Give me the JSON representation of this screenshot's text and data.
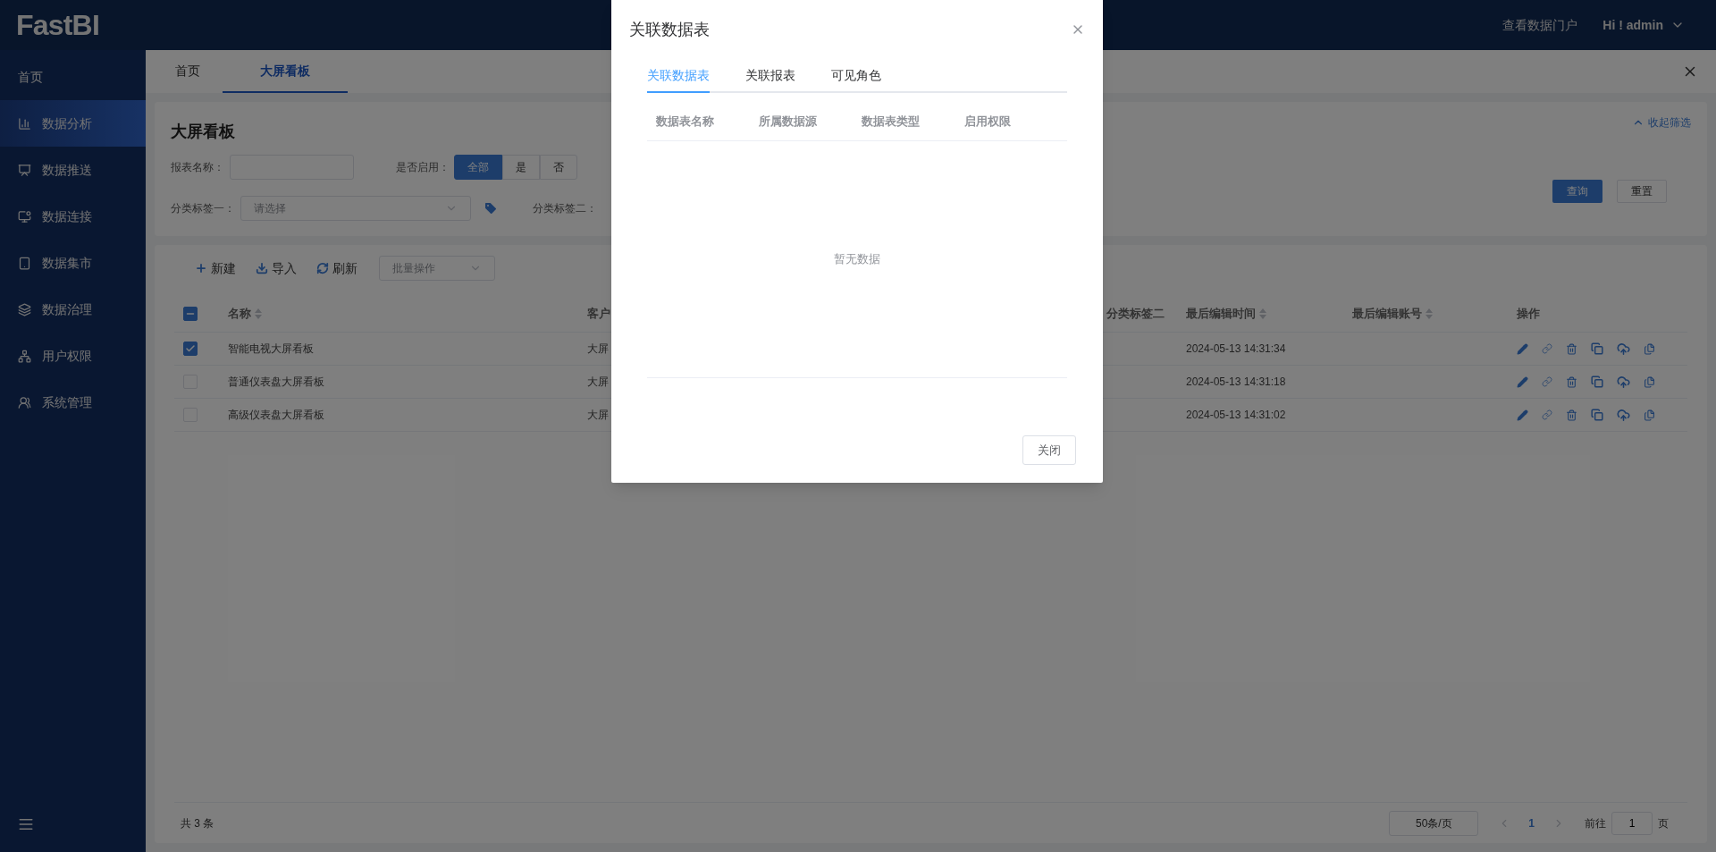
{
  "brand": "FastBI",
  "header": {
    "portal_link": "查看数据门户",
    "user_menu": "Hi ! admin"
  },
  "sidebar": {
    "home": "首页",
    "items": [
      {
        "label": "数据分析",
        "selected": true
      },
      {
        "label": "数据推送",
        "selected": false
      },
      {
        "label": "数据连接",
        "selected": false
      },
      {
        "label": "数据集市",
        "selected": false
      },
      {
        "label": "数据治理",
        "selected": false
      },
      {
        "label": "用户权限",
        "selected": false
      },
      {
        "label": "系统管理",
        "selected": false
      }
    ]
  },
  "tabs": [
    {
      "label": "首页",
      "selected": false
    },
    {
      "label": "大屏看板",
      "selected": true
    }
  ],
  "filter": {
    "title": "大屏看板",
    "collapse_link": "收起筛选",
    "name_label": "报表名称：",
    "enabled_label": "是否启用：",
    "enabled_options": [
      {
        "label": "全部",
        "selected": true
      },
      {
        "label": "是",
        "selected": false
      },
      {
        "label": "否",
        "selected": false
      }
    ],
    "tag1_label": "分类标签一：",
    "tag1_placeholder": "请选择",
    "tag2_label": "分类标签二：",
    "query_button": "查询",
    "reset_button": "重置"
  },
  "toolbar": {
    "new_button": "新建",
    "import_button": "导入",
    "refresh_button": "刷新",
    "batch_placeholder": "批量操作"
  },
  "table": {
    "select_all_indeterminate": true,
    "columns": [
      {
        "label": "名称",
        "sortable": true
      },
      {
        "label": "客户",
        "sortable": false
      },
      {
        "label": "分类标签二",
        "sortable": false
      },
      {
        "label": "最后编辑时间",
        "sortable": true
      },
      {
        "label": "最后编辑账号",
        "sortable": true
      },
      {
        "label": "操作",
        "sortable": false
      }
    ],
    "rows": [
      {
        "checked": true,
        "name": "智能电视大屏看板",
        "column_2": "大屏",
        "last_edit_time": "2024-05-13 14:31:34"
      },
      {
        "checked": false,
        "name": "普通仪表盘大屏看板",
        "column_2": "大屏",
        "last_edit_time": "2024-05-13 14:31:18"
      },
      {
        "checked": false,
        "name": "高级仪表盘大屏看板",
        "column_2": "大屏",
        "last_edit_time": "2024-05-13 14:31:02"
      }
    ]
  },
  "footer": {
    "total": "共 3 条",
    "page_size": "50条/页",
    "pages": [
      {
        "label": "1",
        "selected": true
      }
    ],
    "goto_label": "前往",
    "goto_value": "1",
    "goto_suffix": "页"
  },
  "modal": {
    "title": "关联数据表",
    "tabs": [
      {
        "label": "关联数据表",
        "selected": true
      },
      {
        "label": "关联报表",
        "selected": false
      },
      {
        "label": "可见角色",
        "selected": false
      }
    ],
    "columns": [
      "数据表名称",
      "所属数据源",
      "数据表类型",
      "启用权限"
    ],
    "empty_text": "暂无数据",
    "close_button": "关闭"
  }
}
